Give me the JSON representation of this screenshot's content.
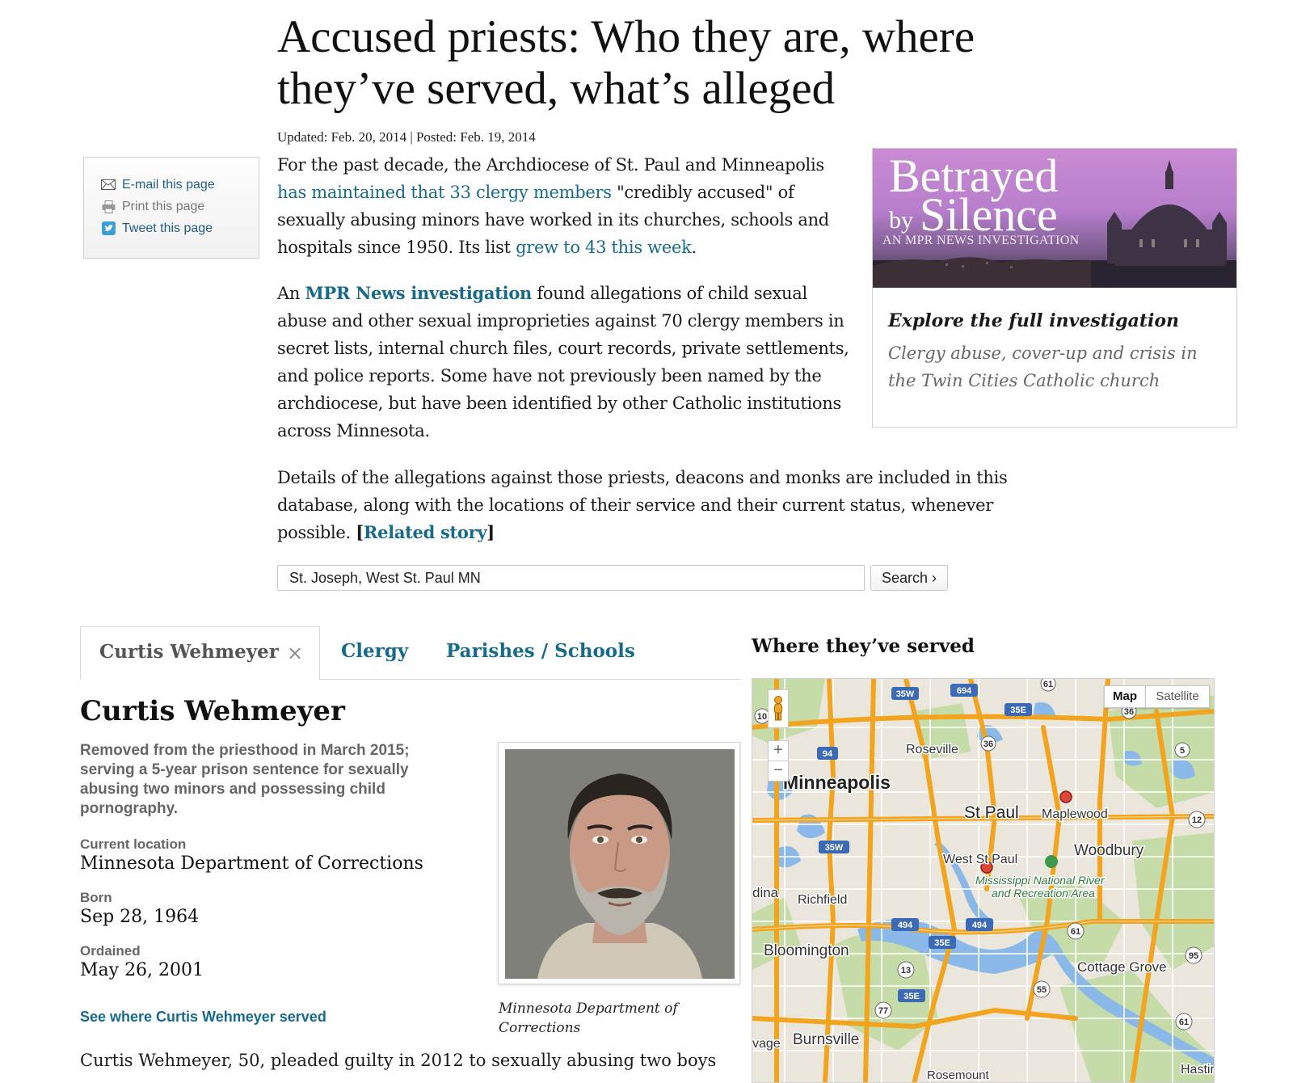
{
  "headline": "Accused priests: Who they are, where they’ve served, what’s alleged",
  "dateline": "Updated: Feb. 20, 2014 | Posted: Feb. 19, 2014",
  "share": {
    "email": "E-mail this page",
    "print": "Print this page",
    "tweet": "Tweet this page"
  },
  "intro": {
    "p1_a": "For the past decade, the Archdiocese of St. Paul and Minneapolis ",
    "p1_link1": "has maintained that 33 clergy members",
    "p1_b": " \"credibly accused\" of sexually abusing minors have worked in its churches, schools and hospitals since 1950. Its list ",
    "p1_link2": "grew to 43 this week",
    "p1_c": ".",
    "p2_a": "An ",
    "p2_link": "MPR News investigation",
    "p2_b": " found allegations of child sexual abuse and other sexual improprieties against 70 clergy members in secret lists, internal church files, court records, private settlements, and police reports. Some have not previously been named by the archdiocese, but have been identified by other Catholic institutions across Minnesota.",
    "p3_a": "Details of the allegations against those priests, deacons and monks are included in this database, along with the locations of their service and their current status, whenever possible. ",
    "p3_bracket_open": "[",
    "p3_link": "Related story",
    "p3_bracket_close": "]"
  },
  "promo": {
    "title_line1": "Betrayed",
    "title_by": "by",
    "title_line2": "Silence",
    "subtitle": "AN MPR NEWS INVESTIGATION",
    "heading": "Explore the full investigation",
    "description": "Clergy abuse, cover-up and crisis in the Twin Cities Catholic church"
  },
  "search": {
    "value": "St. Joseph, West St. Paul MN",
    "button": "Search ›"
  },
  "tabs": {
    "active": "Curtis Wehmeyer",
    "close": "×",
    "clergy": "Clergy",
    "parishes": "Parishes / Schools"
  },
  "map_heading": "Where they’ve served",
  "person": {
    "name": "Curtis Wehmeyer",
    "summary": "Removed from the priesthood in March 2015; serving a 5-year prison sentence for sexually abusing two minors and possessing child pornography.",
    "location_label": "Current location",
    "location_value": "Minnesota Department of Corrections",
    "born_label": "Born",
    "born_value": "Sep 28, 1964",
    "ordained_label": "Ordained",
    "ordained_value": "May 26, 2001",
    "see_link": "See where Curtis Wehmeyer served",
    "photo_caption": "Minnesota Department of Corrections",
    "bio_start": "Curtis Wehmeyer, 50, pleaded guilty in 2012 to sexually abusing two boys"
  },
  "map": {
    "map_button": "Map",
    "satellite_button": "Satellite",
    "zoom_in": "+",
    "zoom_out": "−",
    "places": [
      "Roseville",
      "Minneapolis",
      "St Paul",
      "Maplewood",
      "Woodbury",
      "West St Paul",
      "Mississippi National River",
      "and Recreation Area",
      "Richfield",
      "dina",
      "Bloomington",
      "Cottage Grove",
      "Burnsville",
      "vage",
      "Rosemount",
      "Hastir"
    ],
    "shields": [
      "35W",
      "694",
      "35E",
      "94",
      "35W",
      "494",
      "35E",
      "494",
      "35E",
      "61",
      "36",
      "36",
      "5",
      "12",
      "61",
      "95",
      "55",
      "13",
      "77",
      "61",
      "10"
    ]
  },
  "colors": {
    "link": "#176b8a",
    "highway": "#f2a41f",
    "water": "#8cb8e6",
    "park": "#b8d59a",
    "marker": "#e0453a"
  }
}
